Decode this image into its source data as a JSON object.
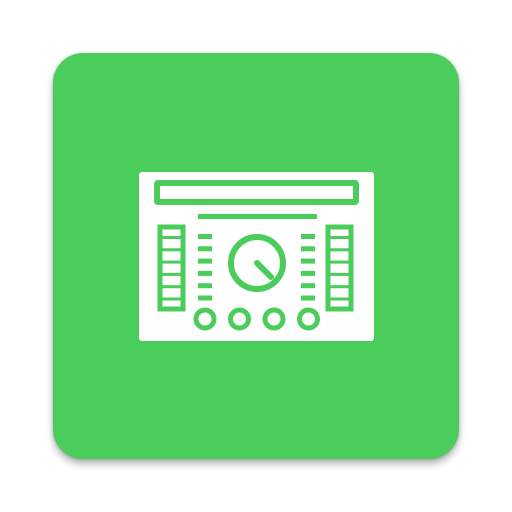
{
  "app_icon": {
    "icon_name": "audio-mixer-console-icon",
    "tile_color": "#4ACD5B",
    "glyph_color": "#FFFFFF",
    "knob_count": 1,
    "button_count": 4,
    "meter_segments_per_side": 6
  }
}
